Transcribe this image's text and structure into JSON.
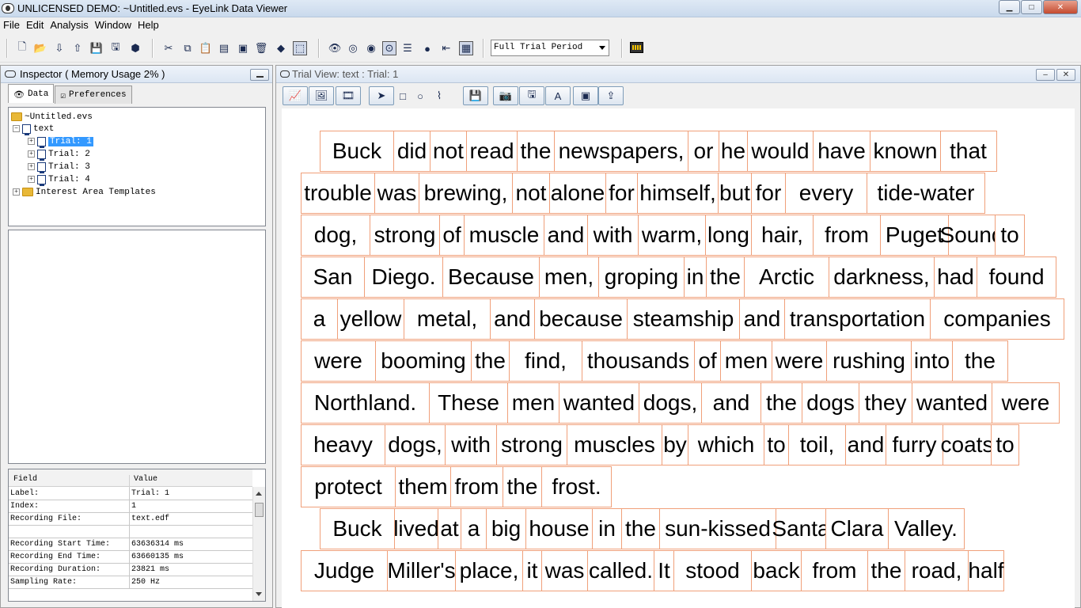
{
  "window": {
    "title": "UNLICENSED DEMO: ~Untitled.evs - EyeLink Data Viewer",
    "min_glyph": "▁",
    "max_glyph": "□",
    "close_glyph": "✕"
  },
  "menu": [
    "File",
    "Edit",
    "Analysis",
    "Window",
    "Help"
  ],
  "toolbar": {
    "icons": [
      "new-icon",
      "open-icon",
      "import-icon",
      "export-icon",
      "save-icon",
      "save-as-icon",
      "package-icon",
      "cut-icon",
      "copy-icon",
      "paste-icon",
      "paste-special-icon",
      "clear-icon",
      "delete-icon",
      "drag-icon",
      "select-icon",
      "eye-icon",
      "eye-settings-icon",
      "eye-view-icon",
      "eye-events-icon",
      "events-list-icon",
      "fixation-icon",
      "interest-area-icon",
      "layout-icon",
      "movie-icon"
    ],
    "period_select": "Full Trial Period"
  },
  "inspector": {
    "title": "Inspector ( Memory Usage 2% )",
    "tabs": {
      "data": "Data",
      "preferences": "Preferences"
    },
    "tree": {
      "root": "~Untitled.evs",
      "session": "text",
      "trials": [
        "Trial: 1",
        "Trial: 2",
        "Trial: 3",
        "Trial: 4"
      ],
      "templates": "Interest Area Templates",
      "expand_glyph": "+",
      "collapse_glyph": "−"
    },
    "props": {
      "header_field": "Field",
      "header_value": "Value",
      "rows": [
        {
          "field": "Label:",
          "value": "Trial: 1"
        },
        {
          "field": "Index:",
          "value": "1"
        },
        {
          "field": "Recording File:",
          "value": "text.edf"
        },
        {
          "field": "",
          "value": ""
        },
        {
          "field": "Recording Start Time:",
          "value": "63636314 ms"
        },
        {
          "field": "Recording End Time:",
          "value": "63660135 ms"
        },
        {
          "field": "Recording Duration:",
          "value": "23821 ms"
        },
        {
          "field": "Sampling Rate:",
          "value": "250 Hz"
        }
      ]
    }
  },
  "trial_view": {
    "title": "Trial View: text : Trial: 1",
    "min_glyph": "–",
    "close_glyph": "✕",
    "toolbar_icons": [
      "line-chart-icon",
      "image-view-icon",
      "film-strip-icon",
      "pointer-icon",
      "rectangle-icon",
      "ellipse-icon",
      "freehand-icon",
      "save-ia-icon",
      "load-image-icon",
      "save-image-icon",
      "text-ia-icon",
      "image-ia-icon",
      "export-ia-icon"
    ],
    "text_lines": [
      [
        "Buck",
        "did",
        "not",
        "read",
        "the",
        "newspapers,",
        "or",
        "he",
        "would",
        "have",
        "known",
        "that"
      ],
      [
        "trouble",
        "was",
        "brewing,",
        "not",
        "alone",
        "for",
        "himself,",
        "but",
        "for",
        "every",
        "tide-water"
      ],
      [
        "dog,",
        "strong",
        "of",
        "muscle",
        "and",
        "with",
        "warm,",
        "long",
        "hair,",
        "from",
        "Puget",
        "Sound",
        "to"
      ],
      [
        "San",
        "Diego.",
        "Because",
        "men,",
        "groping",
        "in",
        "the",
        "Arctic",
        "darkness,",
        "had",
        "found"
      ],
      [
        "a",
        "yellow",
        "metal,",
        "and",
        "because",
        "steamship",
        "and",
        "transportation",
        "companies"
      ],
      [
        "were",
        "booming",
        "the",
        "find,",
        "thousands",
        "of",
        "men",
        "were",
        "rushing",
        "into",
        "the"
      ],
      [
        "Northland.",
        "These",
        "men",
        "wanted",
        "dogs,",
        "and",
        "the",
        "dogs",
        "they",
        "wanted",
        "were"
      ],
      [
        "heavy",
        "dogs,",
        "with",
        "strong",
        "muscles",
        "by",
        "which",
        "to",
        "toil,",
        "and",
        "furry",
        "coats",
        "to"
      ],
      [
        "protect",
        "them",
        "from",
        "the",
        "frost."
      ],
      [
        "Buck",
        "lived",
        "at",
        "a",
        "big",
        "house",
        "in",
        "the",
        "sun-kissed",
        "Santa",
        "Clara",
        "Valley."
      ],
      [
        "Judge",
        "Miller's",
        "place,",
        "it",
        "was",
        "called.",
        "It",
        "stood",
        "back",
        "from",
        "the",
        "road,",
        "half"
      ]
    ]
  }
}
